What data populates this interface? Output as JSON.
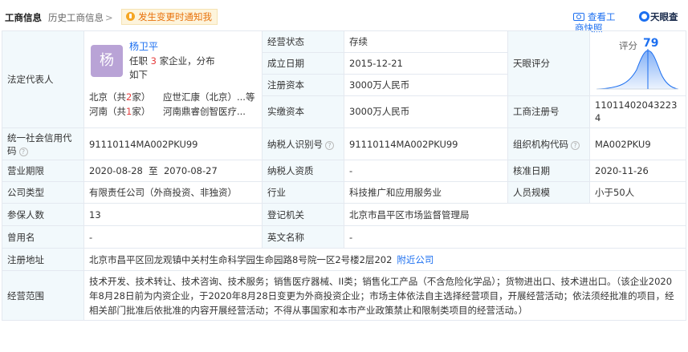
{
  "tabs": {
    "active": "工商信息",
    "history": "历史工商信息",
    "history_chevron": ">",
    "notify": "发生变更时通知我"
  },
  "snapshot": {
    "line1": "查看工",
    "line2": "商快照"
  },
  "brand": {
    "name": "天眼查"
  },
  "legal": {
    "label": "法定代表人",
    "avatar_char": "杨",
    "name": "杨卫平",
    "desc_pre": "任职",
    "count": "3",
    "desc_post": "家企业，分布如下",
    "orgs": [
      {
        "region_pre": "北京（共",
        "region_n": "2",
        "region_post": "家）",
        "name": "应世汇康（北京）...等"
      },
      {
        "region_pre": "河南（共",
        "region_n": "1",
        "region_post": "家）",
        "name": "河南鼎睿创智医疗..."
      }
    ]
  },
  "rows": {
    "status": {
      "label": "经营状态",
      "value": "存续"
    },
    "established": {
      "label": "成立日期",
      "value": "2015-12-21"
    },
    "reg_capital": {
      "label": "注册资本",
      "value": "3000万人民币"
    },
    "paid_capital": {
      "label": "实缴资本",
      "value": "3000万人民币"
    },
    "score": {
      "label": "天眼评分",
      "score_label": "评分",
      "score_value": "79"
    },
    "reg_no": {
      "label": "工商注册号",
      "value": "110114020432234"
    },
    "credit_code": {
      "label": "统一社会信用代码",
      "value": "91110114MA002PKU99"
    },
    "taxpayer_id": {
      "label": "纳税人识别号",
      "value": "91110114MA002PKU99"
    },
    "org_code": {
      "label": "组织机构代码",
      "value": "MA002PKU9"
    },
    "term": {
      "label": "营业期限",
      "value": "2020-08-28  至  2070-08-27"
    },
    "taxpayer_qual": {
      "label": "纳税人资质",
      "value": "-"
    },
    "approve_date": {
      "label": "核准日期",
      "value": "2020-11-26"
    },
    "company_type": {
      "label": "公司类型",
      "value": "有限责任公司（外商投资、非独资）"
    },
    "industry": {
      "label": "行业",
      "value": "科技推广和应用服务业"
    },
    "staff": {
      "label": "人员规模",
      "value": "小于50人"
    },
    "insured": {
      "label": "参保人数",
      "value": "13"
    },
    "authority": {
      "label": "登记机关",
      "value": "北京市昌平区市场监督管理局"
    },
    "former_name": {
      "label": "曾用名",
      "value": "-"
    },
    "english_name": {
      "label": "英文名称",
      "value": "-"
    },
    "address": {
      "label": "注册地址",
      "value": "北京市昌平区回龙观镇中关村生命科学园生命园路8号院一区2号楼2层202",
      "link": "附近公司"
    },
    "scope": {
      "label": "经营范围",
      "value": "技术开发、技术转让、技术咨询、技术服务；销售医疗器械、II类；销售化工产品（不含危险化学品）；货物进出口、技术进出口。（该企业2020年8月28日前为内资企业，于2020年8月28日变更为外商投资企业；市场主体依法自主选择经营项目，开展经营活动；依法须经批准的项目，经相关部门批准后依批准的内容开展经营活动；不得从事国家和本市产业政策禁止和限制类项目的经营活动。）"
    }
  },
  "colors": {
    "accent": "#1c6ff0",
    "label_bg": "#f2f9fc",
    "warn": "#e8720c",
    "red": "#e53f3f"
  }
}
